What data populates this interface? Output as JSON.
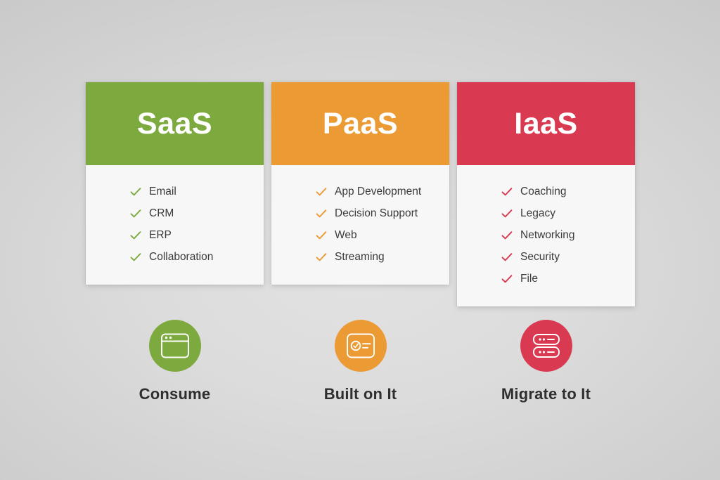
{
  "theme": {
    "background_light": "#e2e2e2",
    "background_dark": "#cacaca",
    "card_body": "#f7f7f7",
    "text_dark": "#3b3b3b",
    "caption_text": "#2f2f2f"
  },
  "columns": [
    {
      "id": "saas",
      "title": "SaaS",
      "color": "#7daa3e",
      "check_color": "#7daa3e",
      "features": [
        "Email",
        "CRM",
        "ERP",
        "Collaboration"
      ],
      "icon_name": "browser-window-icon",
      "caption": "Consume"
    },
    {
      "id": "paas",
      "title": "PaaS",
      "color": "#eb9a34",
      "check_color": "#eb9a34",
      "features": [
        "App Development",
        "Decision Support",
        "Web",
        "Streaming"
      ],
      "icon_name": "certificate-card-icon",
      "caption": "Built on It"
    },
    {
      "id": "iaas",
      "title": "IaaS",
      "color": "#d93a51",
      "check_color": "#d93a51",
      "features": [
        "Coaching",
        "Legacy",
        "Networking",
        "Security",
        "File"
      ],
      "icon_name": "server-stack-icon",
      "caption": "Migrate to It"
    }
  ]
}
